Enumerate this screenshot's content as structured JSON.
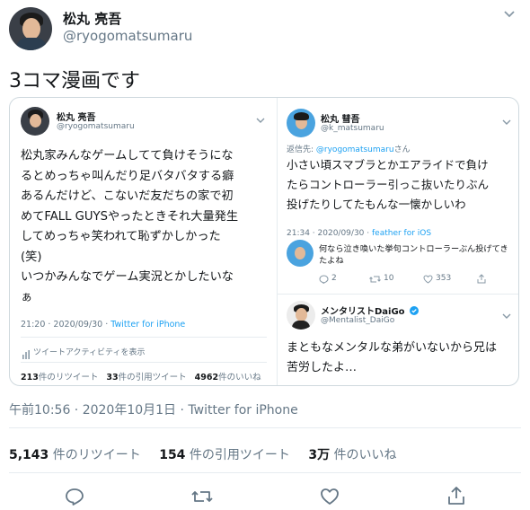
{
  "tweet": {
    "display_name": "松丸 亮吾",
    "handle": "@ryogomatsumaru",
    "text": "3コマ漫画です",
    "timestamp": "午前10:56 · 2020年10月1日 · Twitter for iPhone",
    "stats": {
      "retweets_count": "5,143",
      "retweets_label": "件のリツイート",
      "quotes_count": "154",
      "quotes_label": "件の引用ツイート",
      "likes_count": "3万",
      "likes_label": "件のいいね"
    },
    "actions": [
      "reply-icon",
      "retweet-icon",
      "like-icon",
      "share-icon"
    ]
  },
  "embedded": {
    "left": {
      "display_name": "松丸 亮吾",
      "handle": "@ryogomatsumaru",
      "lines": [
        "松丸家みんなゲームしてて負けそうにな",
        "るとめっちゃ叫んだり足バタバタする癖",
        "あるんだけど、こないだ友だちの家で初",
        "めてFALL GUYSやったときそれ大量発生",
        "してめっちゃ笑われて恥ずかしかった",
        "(笑)",
        "いつかみんなでゲーム実況とかしたいな",
        "ぁ"
      ],
      "time": "21:20 · 2020/09/30 · ",
      "client": "Twitter for iPhone",
      "activity_label": "ツイートアクティビティを表示",
      "retweets_count": "213",
      "retweets_label": "件のリツイート",
      "quotes_count": "33",
      "quotes_label": "件の引用ツイート",
      "likes_count": "4962",
      "likes_label": "件のいいね"
    },
    "right_top": {
      "display_name": "松丸 彗吾",
      "handle": "@k_matsumaru",
      "reply_to_prefix": "返信先: ",
      "reply_to_handle": "@ryogomatsumaru",
      "reply_to_suffix": "さん",
      "lines": [
        "小さい頃スマブラとかエアライドで負け",
        "たらコントローラー引っこ抜いたりぶん",
        "投げたりしてたもんな一懐かしいわ"
      ],
      "time": "21:34 · 2020/09/30 · ",
      "client": "feather for iOS"
    },
    "right_mid": {
      "lines": [
        "何なら泣き喚いた挙句コントローラーぶん投げてき",
        "たよね"
      ],
      "replies": "2",
      "retweets": "10",
      "likes": "353"
    },
    "right_bottom": {
      "display_name": "メンタリストDaiGo",
      "handle": "@Mentalist_DaiGo",
      "lines": [
        "まともなメンタルな弟がいないから兄は",
        "苦労したよ…"
      ]
    }
  },
  "colors": {
    "accent": "#1da1f2",
    "text": "#14171a",
    "muted": "#657786",
    "border": "#cfd9de"
  }
}
